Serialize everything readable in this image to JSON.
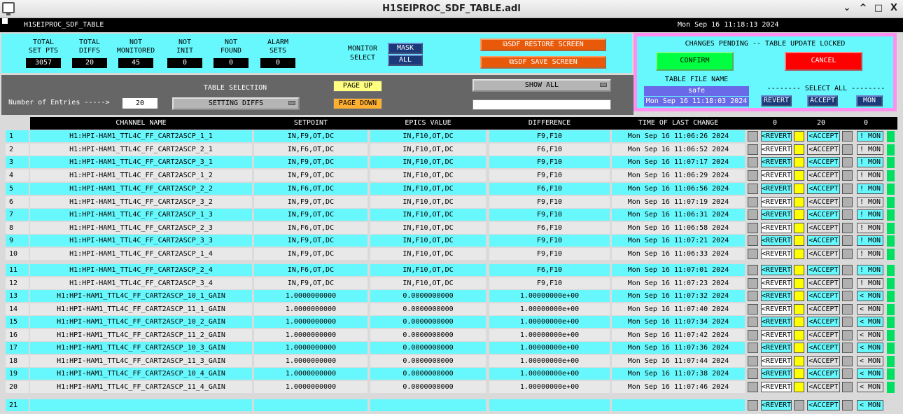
{
  "window": {
    "title": "H1SEIPROC_SDF_TABLE.adl",
    "buttons": [
      "⌄",
      "^",
      "□",
      "X"
    ]
  },
  "header": {
    "screen_name": "H1SEIPROC_SDF_TABLE",
    "datetime": "Mon Sep 16 11:18:13 2024"
  },
  "stats": [
    {
      "label1": "TOTAL",
      "label2": "SET PTS",
      "value": "3057"
    },
    {
      "label1": "TOTAL",
      "label2": "DIFFS",
      "value": "20"
    },
    {
      "label1": "NOT",
      "label2": "MONITORED",
      "value": "45"
    },
    {
      "label1": "NOT",
      "label2": "INIT",
      "value": "0"
    },
    {
      "label1": "NOT",
      "label2": "FOUND",
      "value": "0"
    },
    {
      "label1": "ALARM",
      "label2": "SETS",
      "value": "0"
    }
  ],
  "monitor": {
    "label1": "MONITOR",
    "label2": "SELECT",
    "mask": "MASK",
    "all": "ALL"
  },
  "screens": {
    "restore": "⧉SDF RESTORE SCREEN",
    "save": "⧉SDF SAVE SCREEN"
  },
  "pending": {
    "title": "CHANGES PENDING -- TABLE UPDATE LOCKED",
    "confirm": "CONFIRM",
    "cancel": "CANCEL",
    "file_label": "TABLE FILE NAME",
    "file_name": "safe",
    "file_time": "Mon Sep 16 11:18:03 2024",
    "select_all": "-------- SELECT ALL --------",
    "revert": "REVERT",
    "accept": "ACCEPT",
    "mon": "MON"
  },
  "entries": {
    "label": "Number of Entries ----->",
    "value": "20"
  },
  "table_selection": {
    "label": "TABLE SELECTION",
    "value": "SETTING DIFFS"
  },
  "paging": {
    "up": "PAGE UP",
    "down": "PAGE DOWN"
  },
  "show": {
    "value": "SHOW ALL",
    "filter": ""
  },
  "columns": {
    "channel": "CHANNEL NAME",
    "setpoint": "SETPOINT",
    "epics": "EPICS VALUE",
    "diff": "DIFFERENCE",
    "time": "TIME OF LAST CHANGE",
    "c0a": "0",
    "c20": "20",
    "c0b": "0"
  },
  "row_buttons": {
    "revert": "<REVERT",
    "accept": "<ACCEPT",
    "mon_set": "! MON",
    "mon_unset": "< MON"
  },
  "rows": [
    {
      "n": "1",
      "name": "H1:HPI-HAM1_TTL4C_FF_CART2ASCP_1_1",
      "sp": "IN,F9,OT,DC",
      "ev": "IN,F10,OT,DC",
      "df": "F9,F10",
      "t": "Mon Sep 16 11:06:26 2024",
      "mon": "! MON",
      "hl": true
    },
    {
      "n": "2",
      "name": "H1:HPI-HAM1_TTL4C_FF_CART2ASCP_2_1",
      "sp": "IN,F6,OT,DC",
      "ev": "IN,F10,OT,DC",
      "df": "F6,F10",
      "t": "Mon Sep 16 11:06:52 2024",
      "mon": "! MON",
      "hl": false
    },
    {
      "n": "3",
      "name": "H1:HPI-HAM1_TTL4C_FF_CART2ASCP_3_1",
      "sp": "IN,F9,OT,DC",
      "ev": "IN,F10,OT,DC",
      "df": "F9,F10",
      "t": "Mon Sep 16 11:07:17 2024",
      "mon": "! MON",
      "hl": true
    },
    {
      "n": "4",
      "name": "H1:HPI-HAM1_TTL4C_FF_CART2ASCP_1_2",
      "sp": "IN,F9,OT,DC",
      "ev": "IN,F10,OT,DC",
      "df": "F9,F10",
      "t": "Mon Sep 16 11:06:29 2024",
      "mon": "! MON",
      "hl": false
    },
    {
      "n": "5",
      "name": "H1:HPI-HAM1_TTL4C_FF_CART2ASCP_2_2",
      "sp": "IN,F6,OT,DC",
      "ev": "IN,F10,OT,DC",
      "df": "F6,F10",
      "t": "Mon Sep 16 11:06:56 2024",
      "mon": "! MON",
      "hl": true
    },
    {
      "n": "6",
      "name": "H1:HPI-HAM1_TTL4C_FF_CART2ASCP_3_2",
      "sp": "IN,F9,OT,DC",
      "ev": "IN,F10,OT,DC",
      "df": "F9,F10",
      "t": "Mon Sep 16 11:07:19 2024",
      "mon": "! MON",
      "hl": false
    },
    {
      "n": "7",
      "name": "H1:HPI-HAM1_TTL4C_FF_CART2ASCP_1_3",
      "sp": "IN,F9,OT,DC",
      "ev": "IN,F10,OT,DC",
      "df": "F9,F10",
      "t": "Mon Sep 16 11:06:31 2024",
      "mon": "! MON",
      "hl": true
    },
    {
      "n": "8",
      "name": "H1:HPI-HAM1_TTL4C_FF_CART2ASCP_2_3",
      "sp": "IN,F6,OT,DC",
      "ev": "IN,F10,OT,DC",
      "df": "F6,F10",
      "t": "Mon Sep 16 11:06:58 2024",
      "mon": "! MON",
      "hl": false
    },
    {
      "n": "9",
      "name": "H1:HPI-HAM1_TTL4C_FF_CART2ASCP_3_3",
      "sp": "IN,F9,OT,DC",
      "ev": "IN,F10,OT,DC",
      "df": "F9,F10",
      "t": "Mon Sep 16 11:07:21 2024",
      "mon": "! MON",
      "hl": true
    },
    {
      "n": "10",
      "name": "H1:HPI-HAM1_TTL4C_FF_CART2ASCP_1_4",
      "sp": "IN,F9,OT,DC",
      "ev": "IN,F10,OT,DC",
      "df": "F9,F10",
      "t": "Mon Sep 16 11:06:33 2024",
      "mon": "! MON",
      "hl": false
    },
    {
      "n": "11",
      "name": "H1:HPI-HAM1_TTL4C_FF_CART2ASCP_2_4",
      "sp": "IN,F6,OT,DC",
      "ev": "IN,F10,OT,DC",
      "df": "F6,F10",
      "t": "Mon Sep 16 11:07:01 2024",
      "mon": "! MON",
      "hl": true
    },
    {
      "n": "12",
      "name": "H1:HPI-HAM1_TTL4C_FF_CART2ASCP_3_4",
      "sp": "IN,F9,OT,DC",
      "ev": "IN,F10,OT,DC",
      "df": "F9,F10",
      "t": "Mon Sep 16 11:07:23 2024",
      "mon": "! MON",
      "hl": false
    },
    {
      "n": "13",
      "name": "H1:HPI-HAM1_TTL4C_FF_CART2ASCP_10_1_GAIN",
      "sp": "1.0000000000",
      "ev": "0.0000000000",
      "df": "1.00000000e+00",
      "t": "Mon Sep 16 11:07:32 2024",
      "mon": "< MON",
      "hl": true
    },
    {
      "n": "14",
      "name": "H1:HPI-HAM1_TTL4C_FF_CART2ASCP_11_1_GAIN",
      "sp": "1.0000000000",
      "ev": "0.0000000000",
      "df": "1.00000000e+00",
      "t": "Mon Sep 16 11:07:40 2024",
      "mon": "< MON",
      "hl": false
    },
    {
      "n": "15",
      "name": "H1:HPI-HAM1_TTL4C_FF_CART2ASCP_10_2_GAIN",
      "sp": "1.0000000000",
      "ev": "0.0000000000",
      "df": "1.00000000e+00",
      "t": "Mon Sep 16 11:07:34 2024",
      "mon": "< MON",
      "hl": true
    },
    {
      "n": "16",
      "name": "H1:HPI-HAM1_TTL4C_FF_CART2ASCP_11_2_GAIN",
      "sp": "1.0000000000",
      "ev": "0.0000000000",
      "df": "1.00000000e+00",
      "t": "Mon Sep 16 11:07:42 2024",
      "mon": "< MON",
      "hl": false
    },
    {
      "n": "17",
      "name": "H1:HPI-HAM1_TTL4C_FF_CART2ASCP_10_3_GAIN",
      "sp": "1.0000000000",
      "ev": "0.0000000000",
      "df": "1.00000000e+00",
      "t": "Mon Sep 16 11:07:36 2024",
      "mon": "< MON",
      "hl": true
    },
    {
      "n": "18",
      "name": "H1:HPI-HAM1_TTL4C_FF_CART2ASCP_11_3_GAIN",
      "sp": "1.0000000000",
      "ev": "0.0000000000",
      "df": "1.00000000e+00",
      "t": "Mon Sep 16 11:07:44 2024",
      "mon": "< MON",
      "hl": false
    },
    {
      "n": "19",
      "name": "H1:HPI-HAM1_TTL4C_FF_CART2ASCP_10_4_GAIN",
      "sp": "1.0000000000",
      "ev": "0.0000000000",
      "df": "1.00000000e+00",
      "t": "Mon Sep 16 11:07:38 2024",
      "mon": "< MON",
      "hl": true
    },
    {
      "n": "20",
      "name": "H1:HPI-HAM1_TTL4C_FF_CART2ASCP_11_4_GAIN",
      "sp": "1.0000000000",
      "ev": "0.0000000000",
      "df": "1.00000000e+00",
      "t": "Mon Sep 16 11:07:46 2024",
      "mon": "< MON",
      "hl": false
    },
    {
      "n": "21",
      "name": "",
      "sp": "",
      "ev": "",
      "df": "",
      "t": "",
      "mon": "< MON",
      "hl": true,
      "empty": true
    }
  ],
  "colors": {
    "cyan": "#67f8fd",
    "rowgray": "#e8e8e8",
    "blue_btn": "#1a3a7a",
    "orange": "#e85a0a",
    "green": "#00ff40",
    "red": "#ff0000",
    "pink": "#ff90f0",
    "yellow": "#ffff00"
  }
}
